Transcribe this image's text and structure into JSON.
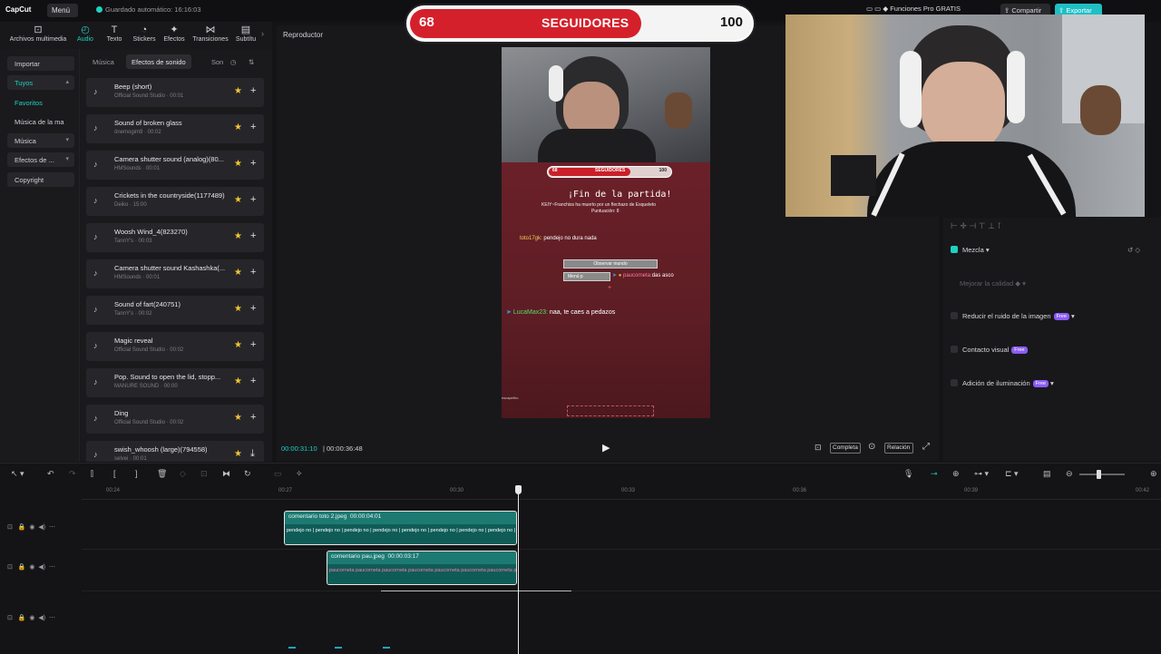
{
  "app": {
    "logo": "CapCut",
    "menu": "Menú",
    "autosave": "Guardado automático: 16:16:03"
  },
  "top_right": {
    "pro": "Funciones Pro GRATIS",
    "share": "Compartir",
    "export": "Exportar"
  },
  "tools": [
    {
      "label": "Archivos multimedia",
      "icon": "media-icon"
    },
    {
      "label": "Audio",
      "icon": "audio-icon",
      "active": true
    },
    {
      "label": "Texto",
      "icon": "text-icon"
    },
    {
      "label": "Stickers",
      "icon": "sticker-icon"
    },
    {
      "label": "Efectos",
      "icon": "effects-icon"
    },
    {
      "label": "Transiciones",
      "icon": "transitions-icon"
    },
    {
      "label": "Subtítu",
      "icon": "captions-icon"
    }
  ],
  "sidebar": {
    "import": "Importar",
    "yours": "Tuyos",
    "favorites": "Favoritos",
    "music_of": "Música de la ma",
    "music": "Música",
    "effects": "Efectos de ...",
    "copyright": "Copyright"
  },
  "sound_tabs": {
    "music": "Música",
    "effects": "Efectos de sonido",
    "son": "Son"
  },
  "sounds": [
    {
      "title": "Beep (short)",
      "sub": "Official Sound Studio · 00:01"
    },
    {
      "title": "Sound of broken glass",
      "sub": "önemogim9 · 00:02"
    },
    {
      "title": "Camera shutter sound (analog)(80...",
      "sub": "HMSounds · 00:01"
    },
    {
      "title": "Crickets in the countryside(1177489)",
      "sub": "Deiko · 15:00"
    },
    {
      "title": "Woosh Wind_4(823270)",
      "sub": "TannY's · 00:03"
    },
    {
      "title": "Camera shutter sound Kashashka(...",
      "sub": "HMSounds · 00:01"
    },
    {
      "title": "Sound of fart(240751)",
      "sub": "TannY's · 00:02"
    },
    {
      "title": "Magic reveal",
      "sub": "Official Sound Studio · 00:02"
    },
    {
      "title": "Pop. Sound to open the lid, stopp...",
      "sub": "MANURE SOUND · 00:00"
    },
    {
      "title": "Ding",
      "sub": "Official Sound Studio · 00:02"
    },
    {
      "title": "swish_whoosh (large)(794558)",
      "sub": "selvei · 00:01"
    }
  ],
  "player": {
    "title": "Reproductor",
    "current_time": "00:00:31:10",
    "total_time": "00:00:36:48",
    "full": "Completa",
    "ratio": "Relación"
  },
  "video_content": {
    "mini_bar": {
      "current": "68",
      "label": "SEGUIDORES",
      "goal": "100",
      "progress": 0.68
    },
    "end_title": "¡Fin de la partida!",
    "killed_line": "KEIY~Franchiss ha muerto por un flechazo de Esqueleto",
    "score_line": "Puntuación: 8",
    "chat1_user": "toto17gk:",
    "chat1_msg": "pendejo no dura nada",
    "btn_observe": "Observar mundo",
    "btn_menu": "Menú p",
    "chat2_user": "paucorneta:",
    "chat2_msg": "das asco",
    "chat3_user": "LucaMax23:",
    "chat3_msg": "naa, te caes a pedazos",
    "small_label": "escapefrio"
  },
  "follower_bar": {
    "current": "68",
    "label": "SEGUIDORES",
    "goal": "100",
    "progress": 0.68
  },
  "right_panel": {
    "mix": "Mezcla",
    "enhance_quality": "Mejorar la calidad",
    "denoise": "Reducir el ruido de la imagen",
    "contrast": "Contacto visual",
    "lighting": "Adición de iluminación",
    "free": "Free"
  },
  "timeline": {
    "ticks": [
      "00:24",
      "00:27",
      "00:30",
      "00:33",
      "00:36",
      "00:39",
      "00:42"
    ],
    "clip1": {
      "title": "comentario toto 2.jpeg",
      "duration": "00:00:04:01",
      "strip": "pendejo no | pendejo no | pendejo no | pendejo no | pendejo no | pendejo no | pendejo no | pendejo no | pendejo no | pendejo no | pe"
    },
    "clip2": {
      "title": "comentario pau.jpeg",
      "duration": "00:00:03:17",
      "strip": "paucorneta paucorneta paucorneta paucorneta paucorneta paucorneta paucorneta paucorneta"
    }
  }
}
